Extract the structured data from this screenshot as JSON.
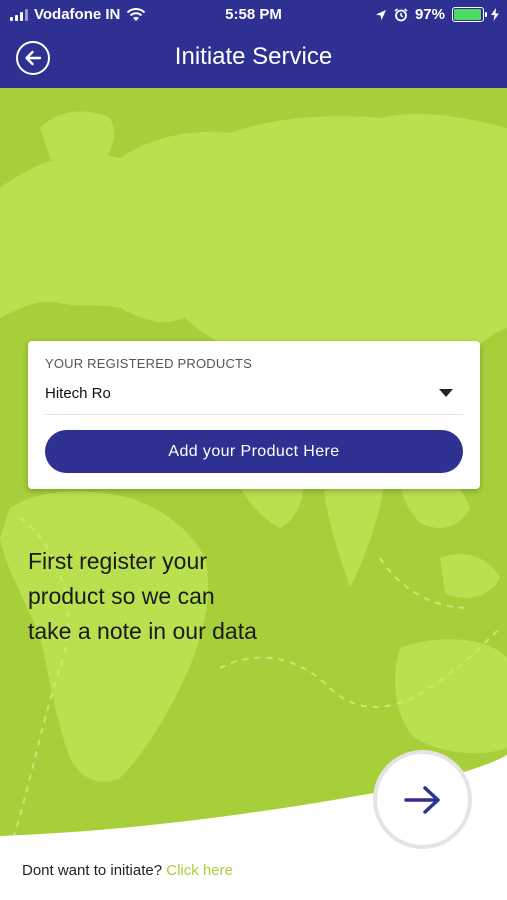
{
  "status_bar": {
    "carrier": "Vodafone IN",
    "time": "5:58 PM",
    "battery": "97%",
    "battery_level": 0.97
  },
  "header": {
    "title": "Initiate Service",
    "back_icon": "back-arrow-circle-icon"
  },
  "colors": {
    "primary": "#2e3192",
    "accent_green": "#a6cf3a",
    "map_land": "#b9e04f"
  },
  "form": {
    "products_label": "YOUR REGISTERED PRODUCTS",
    "selected_product": "Hitech Ro",
    "add_button_label": "Add your Product Here"
  },
  "info": {
    "line1": "First register your",
    "line2": "product so we can",
    "line3": "take a note in our data"
  },
  "next_icon": "arrow-right-icon",
  "footer": {
    "prompt": "Dont want to initiate?",
    "link": "Click here"
  }
}
